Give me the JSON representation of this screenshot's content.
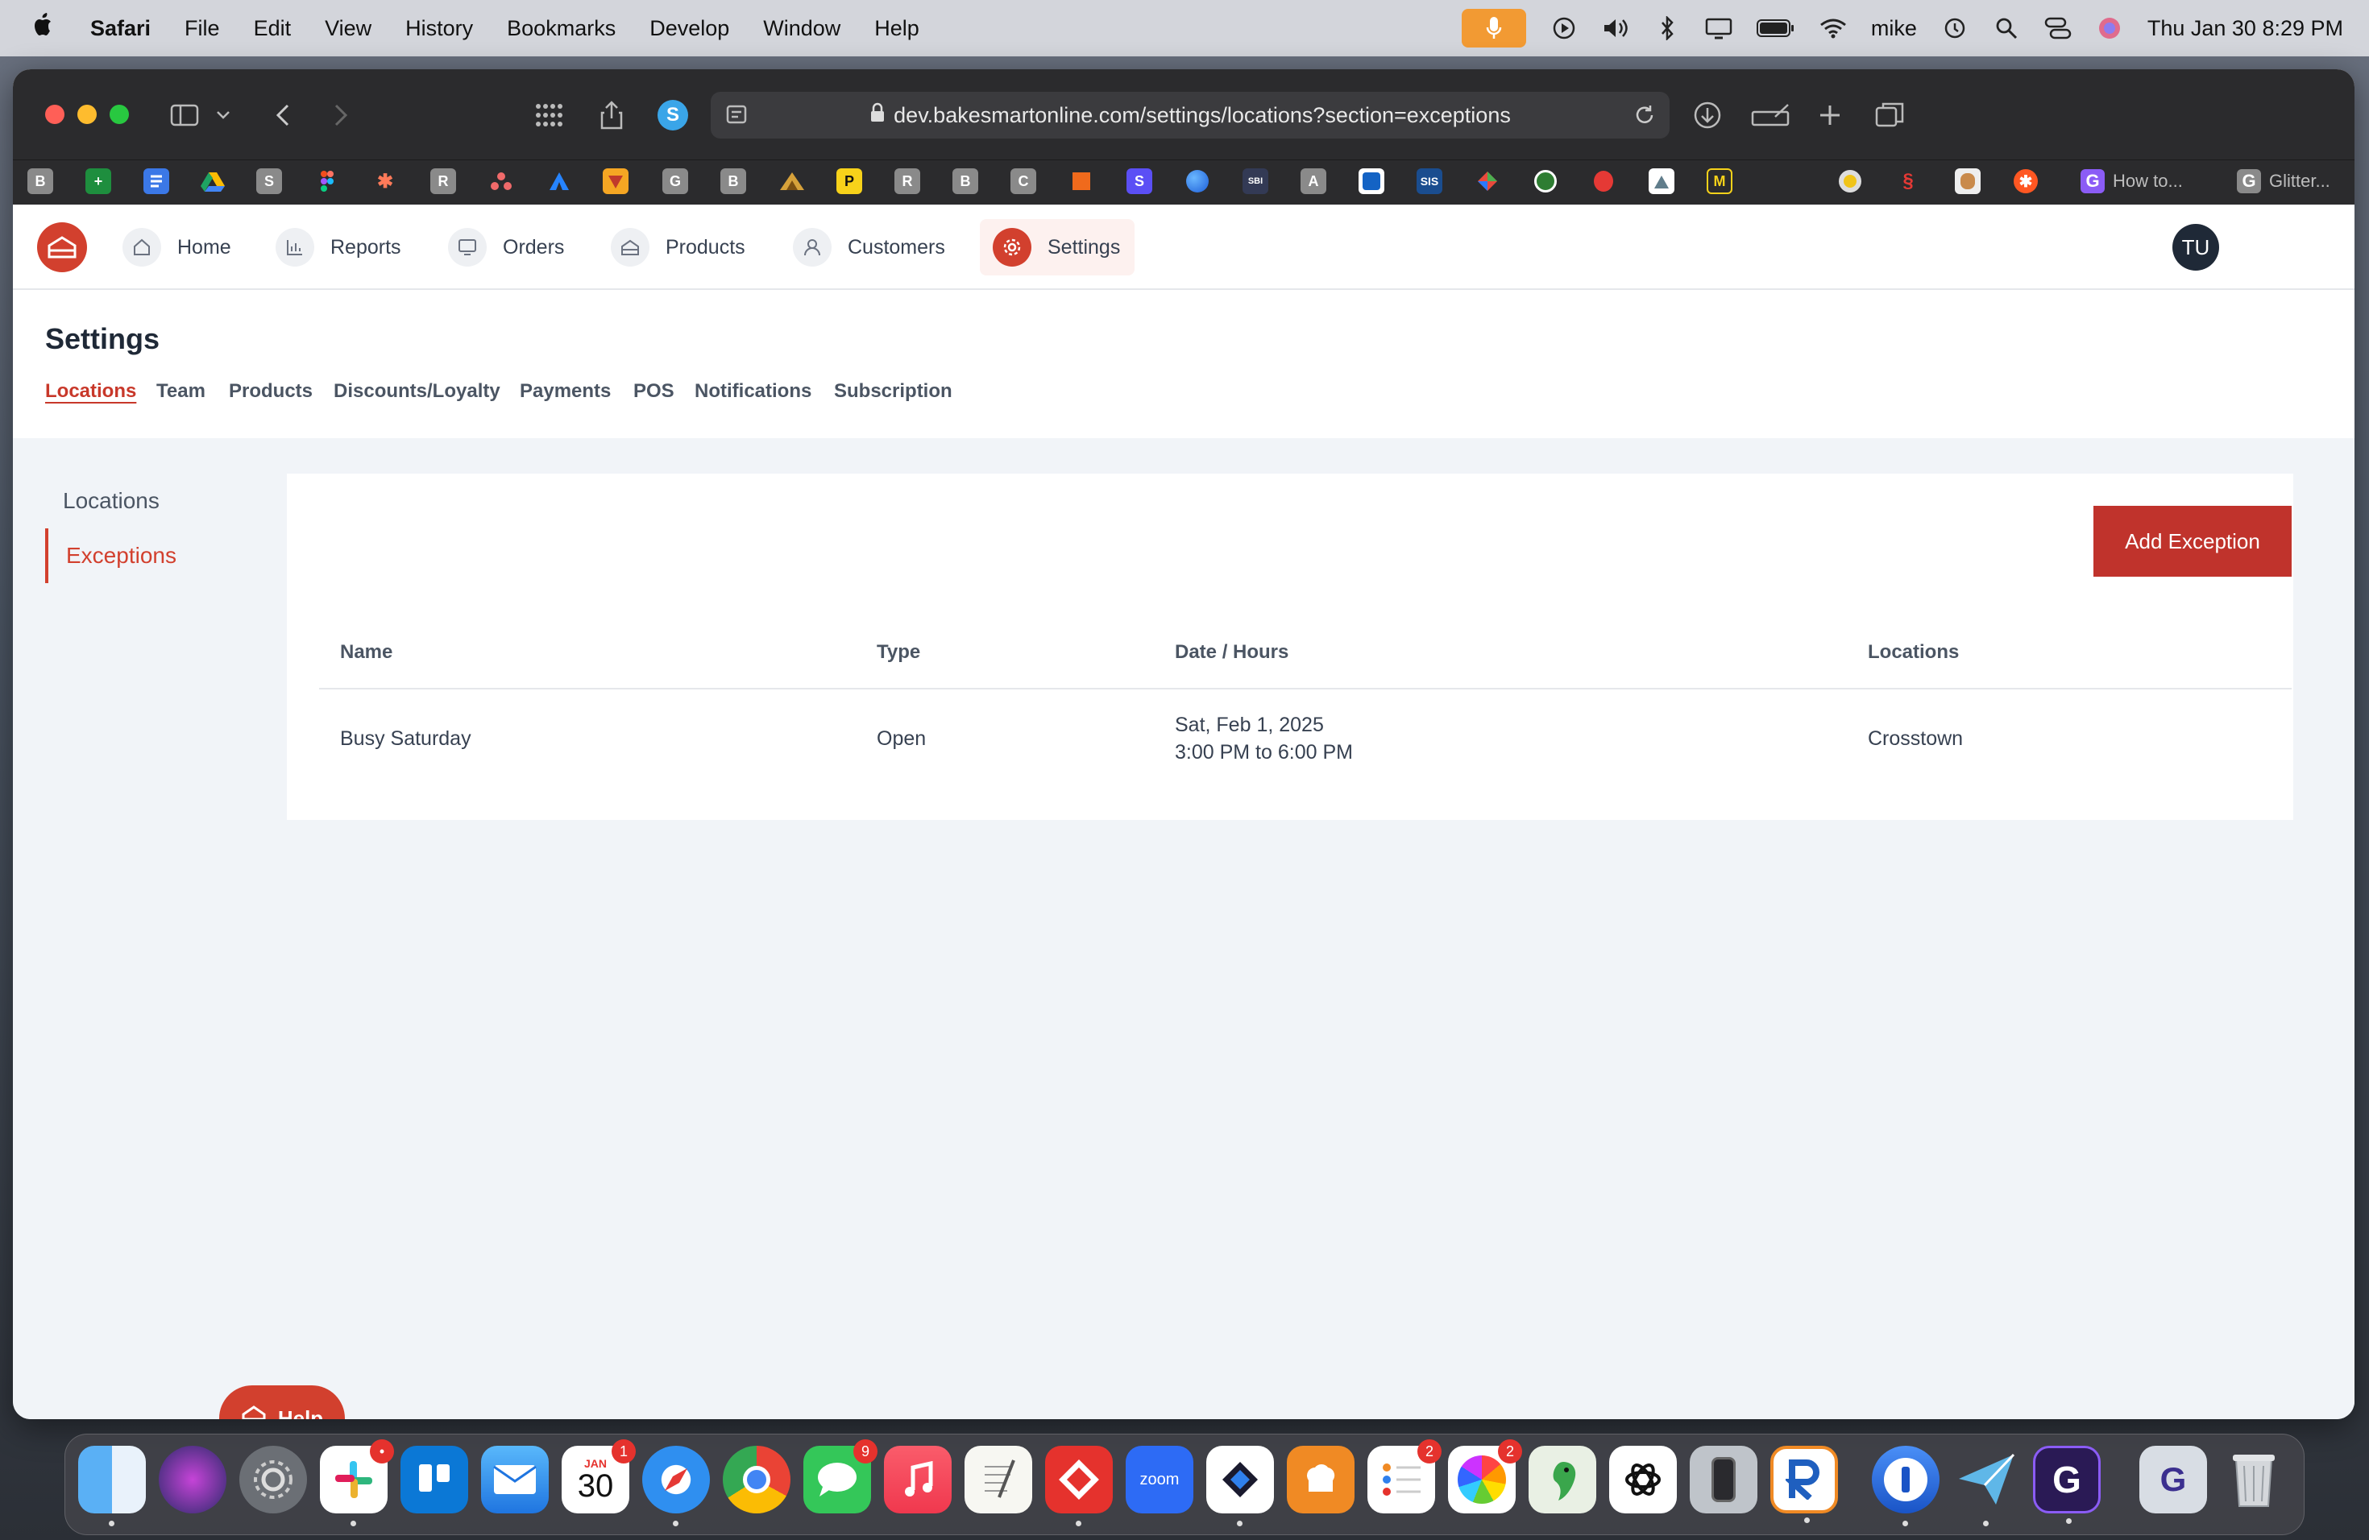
{
  "menubar": {
    "apple": "",
    "items": [
      "Safari",
      "File",
      "Edit",
      "View",
      "History",
      "Bookmarks",
      "Develop",
      "Window",
      "Help"
    ],
    "user": "mike",
    "datetime": "Thu Jan 30  8:29 PM"
  },
  "browser": {
    "url": "dev.bakesmartonline.com/settings/locations?section=exceptions",
    "bookmarks": [
      "B",
      "+",
      "",
      "",
      "S",
      "",
      "",
      "R",
      "",
      "",
      "",
      "G",
      "B",
      "",
      "P",
      "R",
      "B",
      "C",
      "",
      "S",
      "",
      "",
      "A",
      "",
      "SIS",
      "",
      "",
      "",
      "",
      "M",
      "",
      "",
      "",
      "",
      ""
    ],
    "bookmark_tabs": [
      "How to...",
      "Glitter..."
    ]
  },
  "nav": {
    "items": [
      "Home",
      "Reports",
      "Orders",
      "Products",
      "Customers",
      "Settings"
    ],
    "avatar": "TU"
  },
  "settings": {
    "title": "Settings",
    "tabs": [
      "Locations",
      "Team",
      "Products",
      "Discounts/Loyalty",
      "Payments",
      "POS",
      "Notifications",
      "Subscription"
    ],
    "side": [
      "Locations",
      "Exceptions"
    ]
  },
  "exceptions": {
    "add_button": "Add Exception",
    "columns": [
      "Name",
      "Type",
      "Date / Hours",
      "Locations"
    ],
    "rows": [
      {
        "name": "Busy Saturday",
        "type": "Open",
        "date": "Sat, Feb 1, 2025",
        "hours": "3:00 PM to 6:00 PM",
        "location": "Crosstown"
      }
    ]
  },
  "help": "Help",
  "dock": {
    "calendar_month": "JAN",
    "calendar_day": "30",
    "zoom_label": "zoom",
    "badges": {
      "slack": "•",
      "calendar": "1",
      "messages": "9",
      "reminders": "2",
      "photos": "2"
    }
  },
  "colors": {
    "brand": "#d2402e",
    "button": "#c0332c"
  }
}
